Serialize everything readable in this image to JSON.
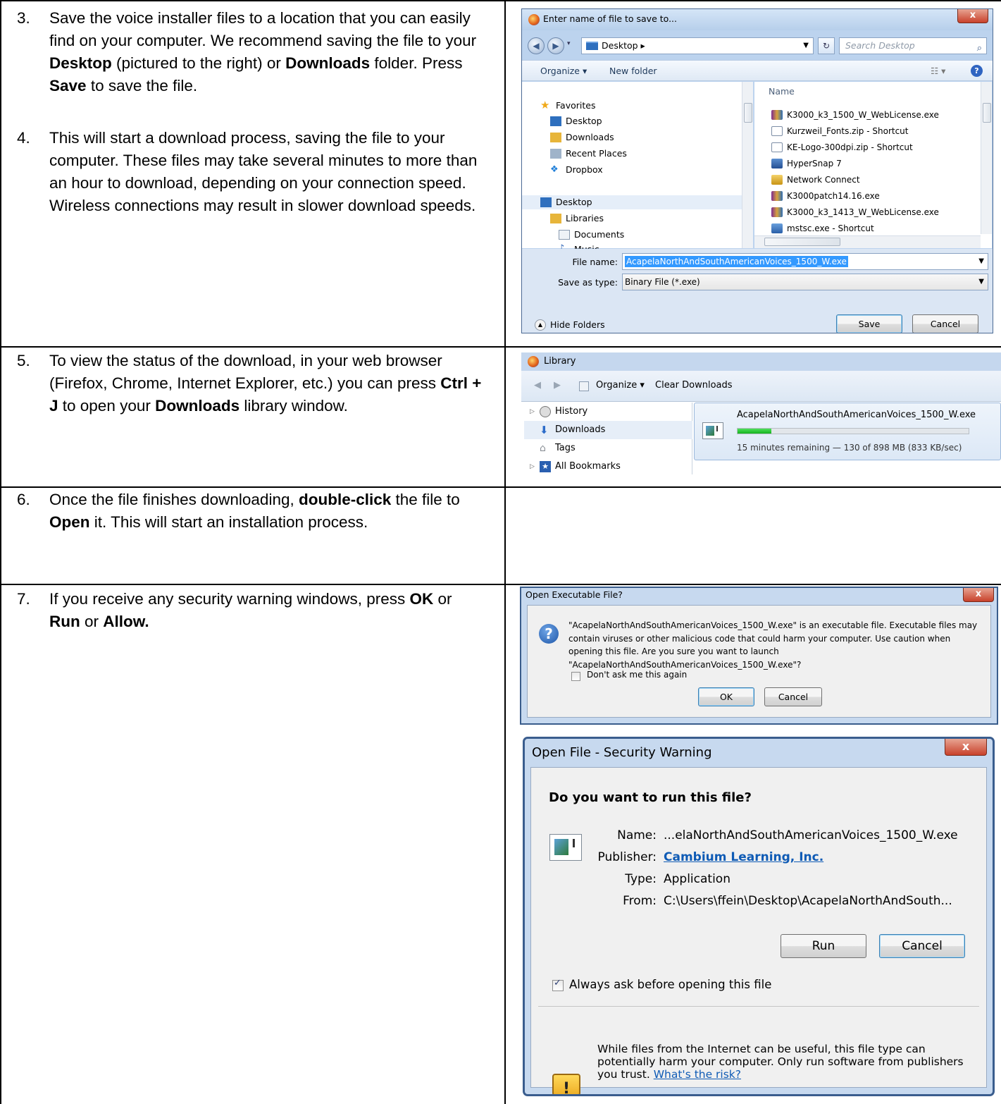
{
  "steps": [
    {
      "num": "3.",
      "parts": [
        {
          "t": "Save the voice installer files to a location that you can easily find on your computer. We recommend saving the file to your "
        },
        {
          "t": "Desktop",
          "b": true
        },
        {
          "t": " (pictured to the right)  or "
        },
        {
          "t": "Downloads",
          "b": true
        },
        {
          "t": " folder. Press "
        },
        {
          "t": "Save",
          "b": true
        },
        {
          "t": " to save the file."
        }
      ]
    },
    {
      "num": "4.",
      "parts": [
        {
          "t": "This will start a download process, saving the file to your computer. These files may take several minutes  to more than an hour to download, depending on your  connection speed. Wireless connections may result in  slower download speeds."
        }
      ]
    },
    {
      "num": "5.",
      "parts": [
        {
          "t": "To view the status of the download, in your web browser (Firefox, Chrome, Internet Explorer, etc.) you  can press "
        },
        {
          "t": "Ctrl + J",
          "b": true
        },
        {
          "t": " to  open your "
        },
        {
          "t": "Downloads",
          "b": true
        },
        {
          "t": " library  window."
        }
      ]
    },
    {
      "num": "6.",
      "parts": [
        {
          "t": "Once the file finishes downloading, "
        },
        {
          "t": "double-click",
          "b": true
        },
        {
          "t": " the file to "
        },
        {
          "t": "Open",
          "b": true
        },
        {
          "t": " it. This will start an installation process."
        }
      ]
    },
    {
      "num": "7.",
      "parts": [
        {
          "t": "If you receive any security warning windows, press "
        },
        {
          "t": "OK",
          "b": true
        },
        {
          "t": " or "
        },
        {
          "t": "Run",
          "b": true
        },
        {
          "t": " or "
        },
        {
          "t": "Allow.",
          "b": true
        }
      ]
    }
  ],
  "save_dialog": {
    "title": "Enter name of file to save to...",
    "close": "x",
    "location": "Desktop  ▸",
    "search_placeholder": "Search Desktop",
    "organize": "Organize ▾",
    "new_folder": "New folder",
    "nav": [
      "Favorites",
      "Desktop",
      "Downloads",
      "Recent Places",
      "Dropbox",
      "Desktop",
      "Libraries",
      "Documents",
      "Music"
    ],
    "column_name": "Name",
    "files": [
      "K3000_k3_1500_W_WebLicense.exe",
      "Kurzweil_Fonts.zip - Shortcut",
      "KE-Logo-300dpi.zip - Shortcut",
      "HyperSnap 7",
      "Network Connect",
      "K3000patch14.16.exe",
      "K3000_k3_1413_W_WebLicense.exe",
      "mstsc.exe - Shortcut"
    ],
    "file_name_label": "File name:",
    "file_name_value": "AcapelaNorthAndSouthAmericanVoices_1500_W.exe",
    "save_type_label": "Save as type:",
    "save_type_value": "Binary File (*.exe)",
    "hide_folders": "Hide Folders",
    "save": "Save",
    "cancel": "Cancel"
  },
  "library": {
    "title": "Library",
    "organize": "Organize ▾",
    "clear_downloads": "Clear Downloads",
    "nav": [
      "History",
      "Downloads",
      "Tags",
      "All Bookmarks"
    ],
    "file": "AcapelaNorthAndSouthAmericanVoices_1500_W.exe",
    "progress": 0.145,
    "status": "15 minutes remaining — 130 of 898 MB (833 KB/sec)"
  },
  "exe_dialog": {
    "title": "Open Executable File?",
    "close": "x",
    "message": "\"AcapelaNorthAndSouthAmericanVoices_1500_W.exe\" is an executable file. Executable files may contain viruses or other malicious code that could harm your computer. Use caution when opening this file. Are you sure you want to launch \"AcapelaNorthAndSouthAmericanVoices_1500_W.exe\"?",
    "dont_ask": "Don't ask me this again",
    "ok": "OK",
    "cancel": "Cancel"
  },
  "security_dialog": {
    "title": "Open File - Security Warning",
    "close": "x",
    "question": "Do you want to run this file?",
    "name_label": "Name:",
    "name_value": "...elaNorthAndSouthAmericanVoices_1500_W.exe",
    "publisher_label": "Publisher:",
    "publisher_value": "Cambium Learning, Inc.",
    "type_label": "Type:",
    "type_value": "Application",
    "from_label": "From:",
    "from_value": "C:\\Users\\ffein\\Desktop\\AcapelaNorthAndSouth...",
    "run": "Run",
    "cancel": "Cancel",
    "always_ask": "Always ask before opening this file",
    "warning": "While files from the Internet can be useful, this file type can potentially harm your computer. Only run software from publishers you trust.",
    "risk_link": "What's the risk?"
  }
}
